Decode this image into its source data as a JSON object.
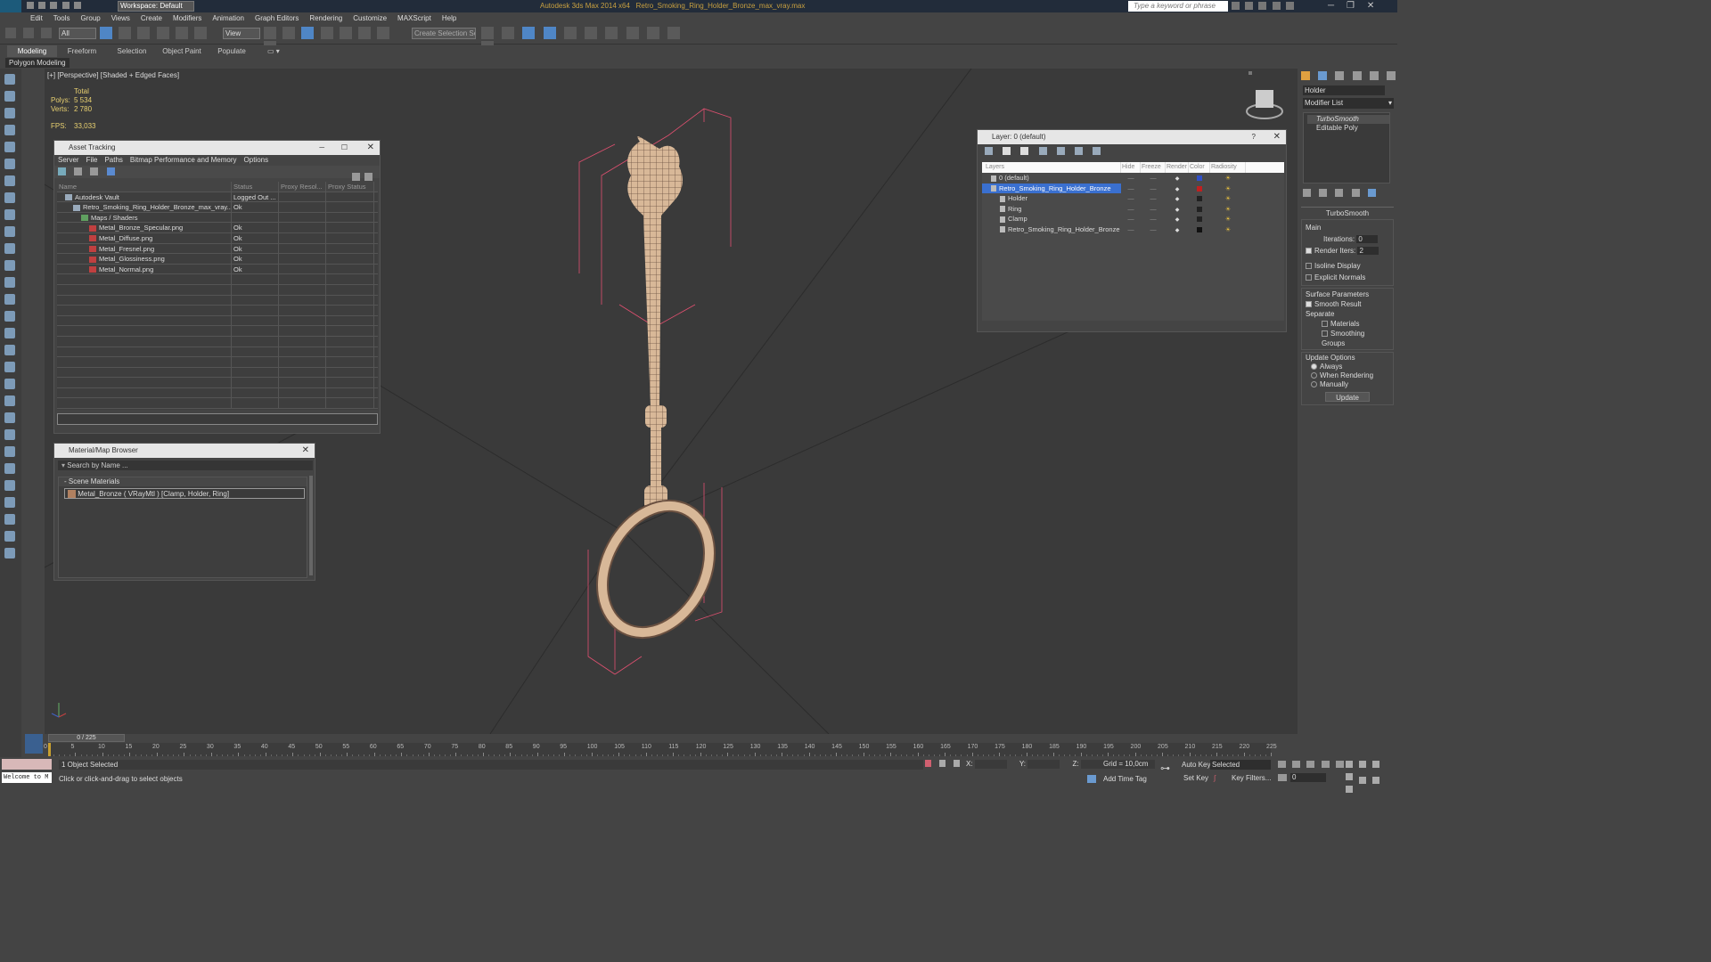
{
  "app": {
    "title": "Autodesk 3ds Max 2014 x64",
    "file": "Retro_Smoking_Ring_Holder_Bronze_max_vray.max",
    "workspace": "Workspace: Default",
    "search_placeholder": "Type a keyword or phrase"
  },
  "menu": [
    "Edit",
    "Tools",
    "Group",
    "Views",
    "Create",
    "Modifiers",
    "Animation",
    "Graph Editors",
    "Rendering",
    "Customize",
    "MAXScript",
    "Help"
  ],
  "toolbar": {
    "filter": "All",
    "refcoord": "View",
    "selection_set": "Create Selection Se"
  },
  "ribbon": {
    "tabs": [
      "Modeling",
      "Freeform",
      "Selection",
      "Object Paint",
      "Populate"
    ],
    "sub": "Polygon Modeling"
  },
  "viewport": {
    "label": "[+] [Perspective] [Shaded + Edged Faces]",
    "stats": {
      "total": "Total",
      "polys_label": "Polys:",
      "polys": "5 534",
      "verts_label": "Verts:",
      "verts": "2 780",
      "fps_label": "FPS:",
      "fps": "33,033"
    }
  },
  "asset_tracking": {
    "title": "Asset Tracking",
    "menu": [
      "Server",
      "File",
      "Paths",
      "Bitmap Performance and Memory",
      "Options"
    ],
    "columns": [
      "Name",
      "Status",
      "Proxy Resol...",
      "Proxy Status"
    ],
    "rows": [
      {
        "name": "Autodesk Vault",
        "status": "Logged Out ...",
        "indent": 1
      },
      {
        "name": "Retro_Smoking_Ring_Holder_Bronze_max_vray....",
        "status": "Ok",
        "indent": 2
      },
      {
        "name": "Maps / Shaders",
        "status": "",
        "indent": 3
      },
      {
        "name": "Metal_Bronze_Specular.png",
        "status": "Ok",
        "indent": 4
      },
      {
        "name": "Metal_Diffuse.png",
        "status": "Ok",
        "indent": 4
      },
      {
        "name": "Metal_Fresnel.png",
        "status": "Ok",
        "indent": 4
      },
      {
        "name": "Metal_Glossiness.png",
        "status": "Ok",
        "indent": 4
      },
      {
        "name": "Metal_Normal.png",
        "status": "Ok",
        "indent": 4
      }
    ]
  },
  "material_browser": {
    "title": "Material/Map Browser",
    "search": "Search by Name ...",
    "section": "Scene Materials",
    "item": "Metal_Bronze  ( VRayMtl )  [Clamp, Holder, Ring]"
  },
  "layer_manager": {
    "title": "Layer: 0 (default)",
    "columns": [
      "Layers",
      "Hide",
      "Freeze",
      "Render",
      "Color",
      "Radiosity"
    ],
    "rows": [
      {
        "name": "0 (default)",
        "indent": 1,
        "selected": false,
        "color": "#3050c8"
      },
      {
        "name": "Retro_Smoking_Ring_Holder_Bronze",
        "indent": 1,
        "selected": true,
        "color": "#c02020"
      },
      {
        "name": "Holder",
        "indent": 2,
        "selected": false,
        "color": "#222222"
      },
      {
        "name": "Ring",
        "indent": 2,
        "selected": false,
        "color": "#222222"
      },
      {
        "name": "Clamp",
        "indent": 2,
        "selected": false,
        "color": "#222222"
      },
      {
        "name": "Retro_Smoking_Ring_Holder_Bronze",
        "indent": 2,
        "selected": false,
        "color": "#111111"
      }
    ]
  },
  "command_panel": {
    "object_name": "Holder",
    "modifier_list": "Modifier List",
    "stack": [
      "TurboSmooth",
      "Editable Poly"
    ],
    "rollout_title": "TurboSmooth",
    "main": "Main",
    "iterations_label": "Iterations:",
    "iterations": "0",
    "render_iters_label": "Render Iters:",
    "render_iters": "2",
    "isoline": "Isoline Display",
    "explicit": "Explicit Normals",
    "surface_params": "Surface Parameters",
    "smooth_result": "Smooth Result",
    "separate": "Separate",
    "materials": "Materials",
    "smoothing_groups": "Smoothing Groups",
    "update_options": "Update Options",
    "always": "Always",
    "when_rendering": "When Rendering",
    "manually": "Manually",
    "update_button": "Update"
  },
  "timeline": {
    "frame": "0 / 225",
    "ticks": [
      "0",
      "5",
      "10",
      "15",
      "20",
      "25",
      "30",
      "35",
      "40",
      "45",
      "50",
      "55",
      "60",
      "65",
      "70",
      "75",
      "80",
      "85",
      "90",
      "95",
      "100",
      "105",
      "110",
      "115",
      "120",
      "125",
      "130",
      "135",
      "140",
      "145",
      "150",
      "155",
      "160",
      "165",
      "170",
      "175",
      "180",
      "185",
      "190",
      "195",
      "200",
      "205",
      "210",
      "215",
      "220",
      "225"
    ]
  },
  "status": {
    "welcome": "Welcome to M",
    "selected": "1 Object Selected",
    "hint": "Click or click-and-drag to select objects",
    "x_label": "X:",
    "y_label": "Y:",
    "z_label": "Z:",
    "grid": "Grid = 10,0cm",
    "add_time_tag": "Add Time Tag",
    "auto_key": "Auto Key",
    "set_key": "Set Key",
    "selected_dropdown": "Selected",
    "key_filters": "Key Filters...",
    "frame_field": "0"
  },
  "colors": {
    "bronze": "#d8b898",
    "wire": "#6a5040",
    "bbox": "#e05070",
    "selection": "#3a70d0"
  }
}
